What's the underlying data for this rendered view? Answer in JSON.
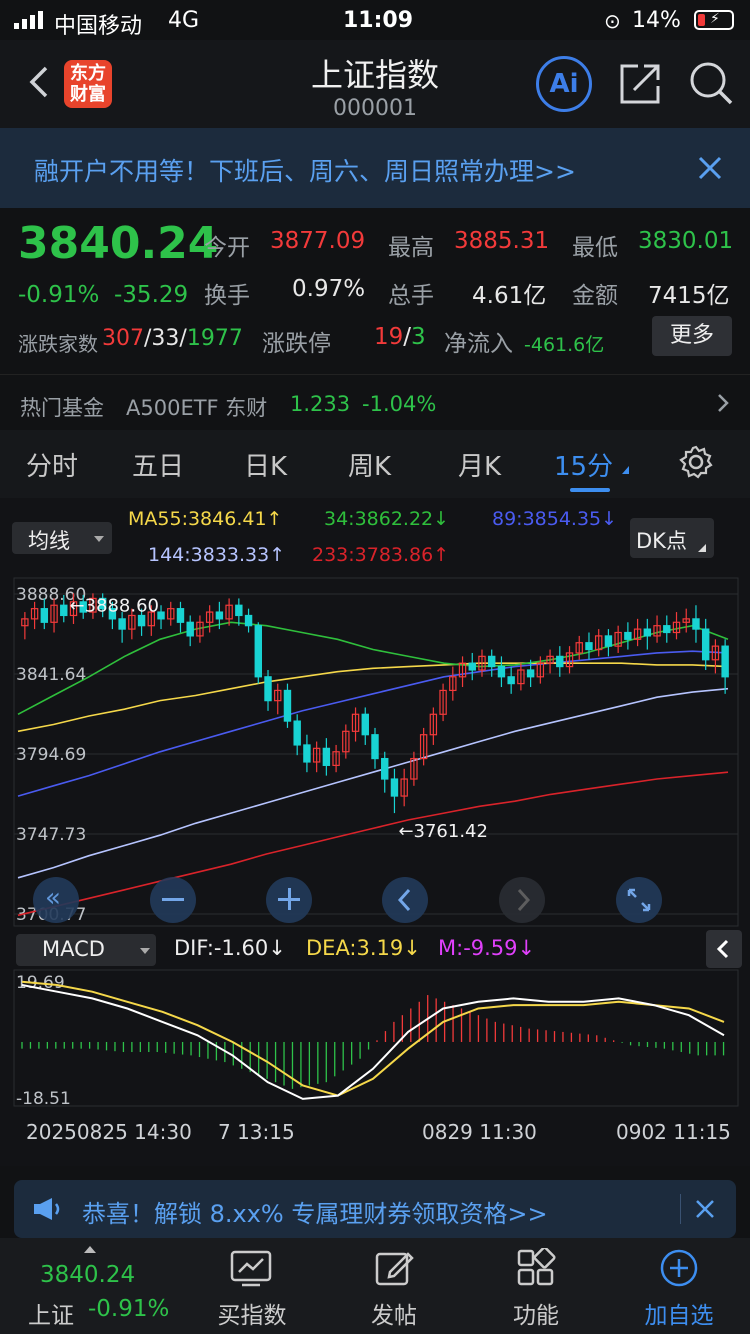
{
  "status": {
    "carrier": "中国移动",
    "network": "4G",
    "time": "11:09",
    "battery": "14%"
  },
  "header": {
    "logo_line1": "东方",
    "logo_line2": "财富",
    "title": "上证指数",
    "code": "000001"
  },
  "banner": {
    "text": "融开户不用等！下班后、周六、周日照常办理>>"
  },
  "quote": {
    "price": "3840.24",
    "change_pct": "-0.91%",
    "change": "-35.29",
    "open_label": "今开",
    "open": "3877.09",
    "high_label": "最高",
    "high": "3885.31",
    "low_label": "最低",
    "low": "3830.01",
    "turnover_label": "换手",
    "turnover": "0.97%",
    "volume_label": "总手",
    "volume": "4.61亿",
    "amount_label": "金额",
    "amount": "7415亿",
    "breadth_label": "涨跌家数",
    "breadth_up": "307",
    "breadth_flat": "33",
    "breadth_down": "1977",
    "limit_label": "涨跌停",
    "limit_up": "19",
    "limit_down": "3",
    "netflow_label": "净流入",
    "netflow": "-461.6亿",
    "more": "更多",
    "fund_label": "热门基金",
    "fund_name": "A500ETF 东财",
    "fund_price": "1.233",
    "fund_change": "-1.04%"
  },
  "tabs": [
    "分时",
    "五日",
    "日K",
    "周K",
    "月K",
    "15分"
  ],
  "indicator": {
    "ma_btn": "均线",
    "dk_btn": "DK点",
    "ma55": "MA55:3846.41↑",
    "ma34": "34:3862.22↓",
    "ma89": "89:3854.35↓",
    "ma144": "144:3833.33↑",
    "ma233": "233:3783.86↑",
    "colors": {
      "ma55": "#f5d84a",
      "ma34": "#2fbf3c",
      "ma89": "#4a5bf0",
      "ma144": "#b6c4ff",
      "ma233": "#d9232a",
      "up": "#f23a3a",
      "down": "#19d3d3"
    }
  },
  "kline": {
    "y_labels": [
      "3888.60",
      "3841.64",
      "3794.69",
      "3747.73",
      "3700.77"
    ],
    "y_values": [
      3888.6,
      3841.64,
      3794.69,
      3747.73,
      3700.77
    ],
    "high_annot": "3888.60",
    "low_annot": "3761.42",
    "candles": [
      [
        3870,
        3874,
        3862,
        3878
      ],
      [
        3874,
        3880,
        3868,
        3884
      ],
      [
        3880,
        3872,
        3868,
        3886
      ],
      [
        3872,
        3882,
        3866,
        3886
      ],
      [
        3882,
        3876,
        3872,
        3888
      ],
      [
        3876,
        3884,
        3871,
        3889
      ],
      [
        3884,
        3878,
        3874,
        3888
      ],
      [
        3878,
        3886,
        3874,
        3889
      ],
      [
        3886,
        3880,
        3875,
        3889
      ],
      [
        3880,
        3874,
        3868,
        3884
      ],
      [
        3874,
        3868,
        3860,
        3878
      ],
      [
        3868,
        3876,
        3862,
        3880
      ],
      [
        3876,
        3870,
        3864,
        3880
      ],
      [
        3870,
        3878,
        3864,
        3882
      ],
      [
        3878,
        3874,
        3868,
        3882
      ],
      [
        3874,
        3880,
        3870,
        3884
      ],
      [
        3880,
        3872,
        3866,
        3884
      ],
      [
        3872,
        3864,
        3858,
        3876
      ],
      [
        3864,
        3872,
        3860,
        3876
      ],
      [
        3872,
        3878,
        3866,
        3882
      ],
      [
        3878,
        3874,
        3868,
        3884
      ],
      [
        3874,
        3882,
        3870,
        3886
      ],
      [
        3882,
        3876,
        3870,
        3886
      ],
      [
        3876,
        3870,
        3866,
        3880
      ],
      [
        3870,
        3840,
        3836,
        3872
      ],
      [
        3840,
        3826,
        3820,
        3844
      ],
      [
        3826,
        3832,
        3818,
        3836
      ],
      [
        3832,
        3814,
        3810,
        3836
      ],
      [
        3814,
        3800,
        3794,
        3818
      ],
      [
        3800,
        3790,
        3784,
        3806
      ],
      [
        3790,
        3798,
        3784,
        3802
      ],
      [
        3798,
        3788,
        3782,
        3804
      ],
      [
        3788,
        3796,
        3784,
        3800
      ],
      [
        3796,
        3808,
        3792,
        3812
      ],
      [
        3808,
        3818,
        3802,
        3822
      ],
      [
        3818,
        3806,
        3800,
        3822
      ],
      [
        3806,
        3792,
        3786,
        3810
      ],
      [
        3792,
        3780,
        3772,
        3796
      ],
      [
        3780,
        3770,
        3760,
        3786
      ],
      [
        3770,
        3780,
        3764,
        3786
      ],
      [
        3780,
        3792,
        3776,
        3796
      ],
      [
        3792,
        3806,
        3788,
        3810
      ],
      [
        3806,
        3818,
        3800,
        3822
      ],
      [
        3818,
        3832,
        3814,
        3836
      ],
      [
        3832,
        3840,
        3826,
        3846
      ],
      [
        3840,
        3848,
        3834,
        3852
      ],
      [
        3848,
        3844,
        3838,
        3854
      ],
      [
        3844,
        3852,
        3840,
        3856
      ],
      [
        3852,
        3846,
        3840,
        3856
      ],
      [
        3846,
        3840,
        3834,
        3852
      ],
      [
        3840,
        3836,
        3830,
        3846
      ],
      [
        3836,
        3844,
        3832,
        3848
      ],
      [
        3844,
        3840,
        3834,
        3850
      ],
      [
        3840,
        3848,
        3836,
        3852
      ],
      [
        3848,
        3852,
        3842,
        3856
      ],
      [
        3852,
        3846,
        3840,
        3858
      ],
      [
        3846,
        3854,
        3842,
        3858
      ],
      [
        3854,
        3860,
        3850,
        3864
      ],
      [
        3860,
        3856,
        3850,
        3866
      ],
      [
        3856,
        3864,
        3852,
        3868
      ],
      [
        3864,
        3858,
        3852,
        3868
      ],
      [
        3858,
        3866,
        3854,
        3870
      ],
      [
        3866,
        3862,
        3856,
        3872
      ],
      [
        3862,
        3868,
        3858,
        3874
      ],
      [
        3868,
        3864,
        3856,
        3874
      ],
      [
        3864,
        3870,
        3860,
        3876
      ],
      [
        3870,
        3866,
        3860,
        3876
      ],
      [
        3866,
        3872,
        3862,
        3878
      ],
      [
        3872,
        3874,
        3866,
        3880
      ],
      [
        3874,
        3868,
        3860,
        3882
      ],
      [
        3868,
        3850,
        3844,
        3874
      ],
      [
        3850,
        3858,
        3842,
        3862
      ],
      [
        3858,
        3840,
        3830,
        3862
      ]
    ],
    "ma55": [
      3808,
      3812,
      3817,
      3821,
      3826,
      3829,
      3833,
      3837,
      3840,
      3843,
      3845,
      3846,
      3847,
      3848,
      3848,
      3848,
      3848,
      3848,
      3847,
      3847,
      3846
    ],
    "ma34": [
      3818,
      3829,
      3840,
      3852,
      3862,
      3868,
      3872,
      3870,
      3866,
      3862,
      3856,
      3852,
      3848,
      3846,
      3847,
      3850,
      3854,
      3860,
      3866,
      3870,
      3862
    ],
    "ma89": [
      3770,
      3776,
      3782,
      3789,
      3796,
      3802,
      3808,
      3814,
      3820,
      3825,
      3830,
      3835,
      3840,
      3843,
      3846,
      3848,
      3850,
      3852,
      3854,
      3855,
      3854
    ],
    "ma144": [
      3722,
      3728,
      3735,
      3741,
      3747,
      3754,
      3760,
      3766,
      3772,
      3778,
      3784,
      3790,
      3796,
      3802,
      3808,
      3813,
      3818,
      3823,
      3828,
      3831,
      3833
    ],
    "ma233": [
      3700,
      3705,
      3710,
      3715,
      3720,
      3725,
      3730,
      3736,
      3741,
      3746,
      3751,
      3756,
      3760,
      3764,
      3767,
      3771,
      3774,
      3777,
      3780,
      3782,
      3784
    ]
  },
  "macd": {
    "label": "MACD",
    "dif": "DIF:-1.60↓",
    "dea": "DEA:3.19↓",
    "m": "M:-9.59↓",
    "y_labels": [
      "19.69",
      "-18.51"
    ],
    "y_values": [
      19.69,
      -18.51
    ],
    "dif_series": [
      17,
      15,
      13,
      10,
      6,
      2,
      -4,
      -12,
      -17,
      -16,
      -8,
      3,
      10,
      12,
      13,
      12,
      12,
      13,
      11,
      8,
      2
    ],
    "dea_series": [
      18,
      17,
      15,
      12,
      9,
      5,
      0,
      -6,
      -13,
      -16,
      -11,
      -2,
      6,
      10,
      11,
      11,
      11,
      12,
      11,
      10,
      6
    ],
    "bars": [
      -2,
      -2,
      -2,
      -3,
      -3,
      -4,
      -6,
      -10,
      -14,
      -12,
      -5,
      6,
      14,
      10,
      6,
      4,
      3,
      2,
      -1,
      -2,
      -4
    ]
  },
  "x_labels": [
    "20250825 14:30",
    "7 13:15",
    "0829 11:30",
    "0902 11:15"
  ],
  "promo": {
    "text": "恭喜！解锁 8.xx% 专属理财券领取资格>>"
  },
  "bottom": {
    "price": "3840.24",
    "name": "上证",
    "pct": "-0.91%",
    "items": [
      "买指数",
      "发帖",
      "功能",
      "加自选"
    ]
  }
}
